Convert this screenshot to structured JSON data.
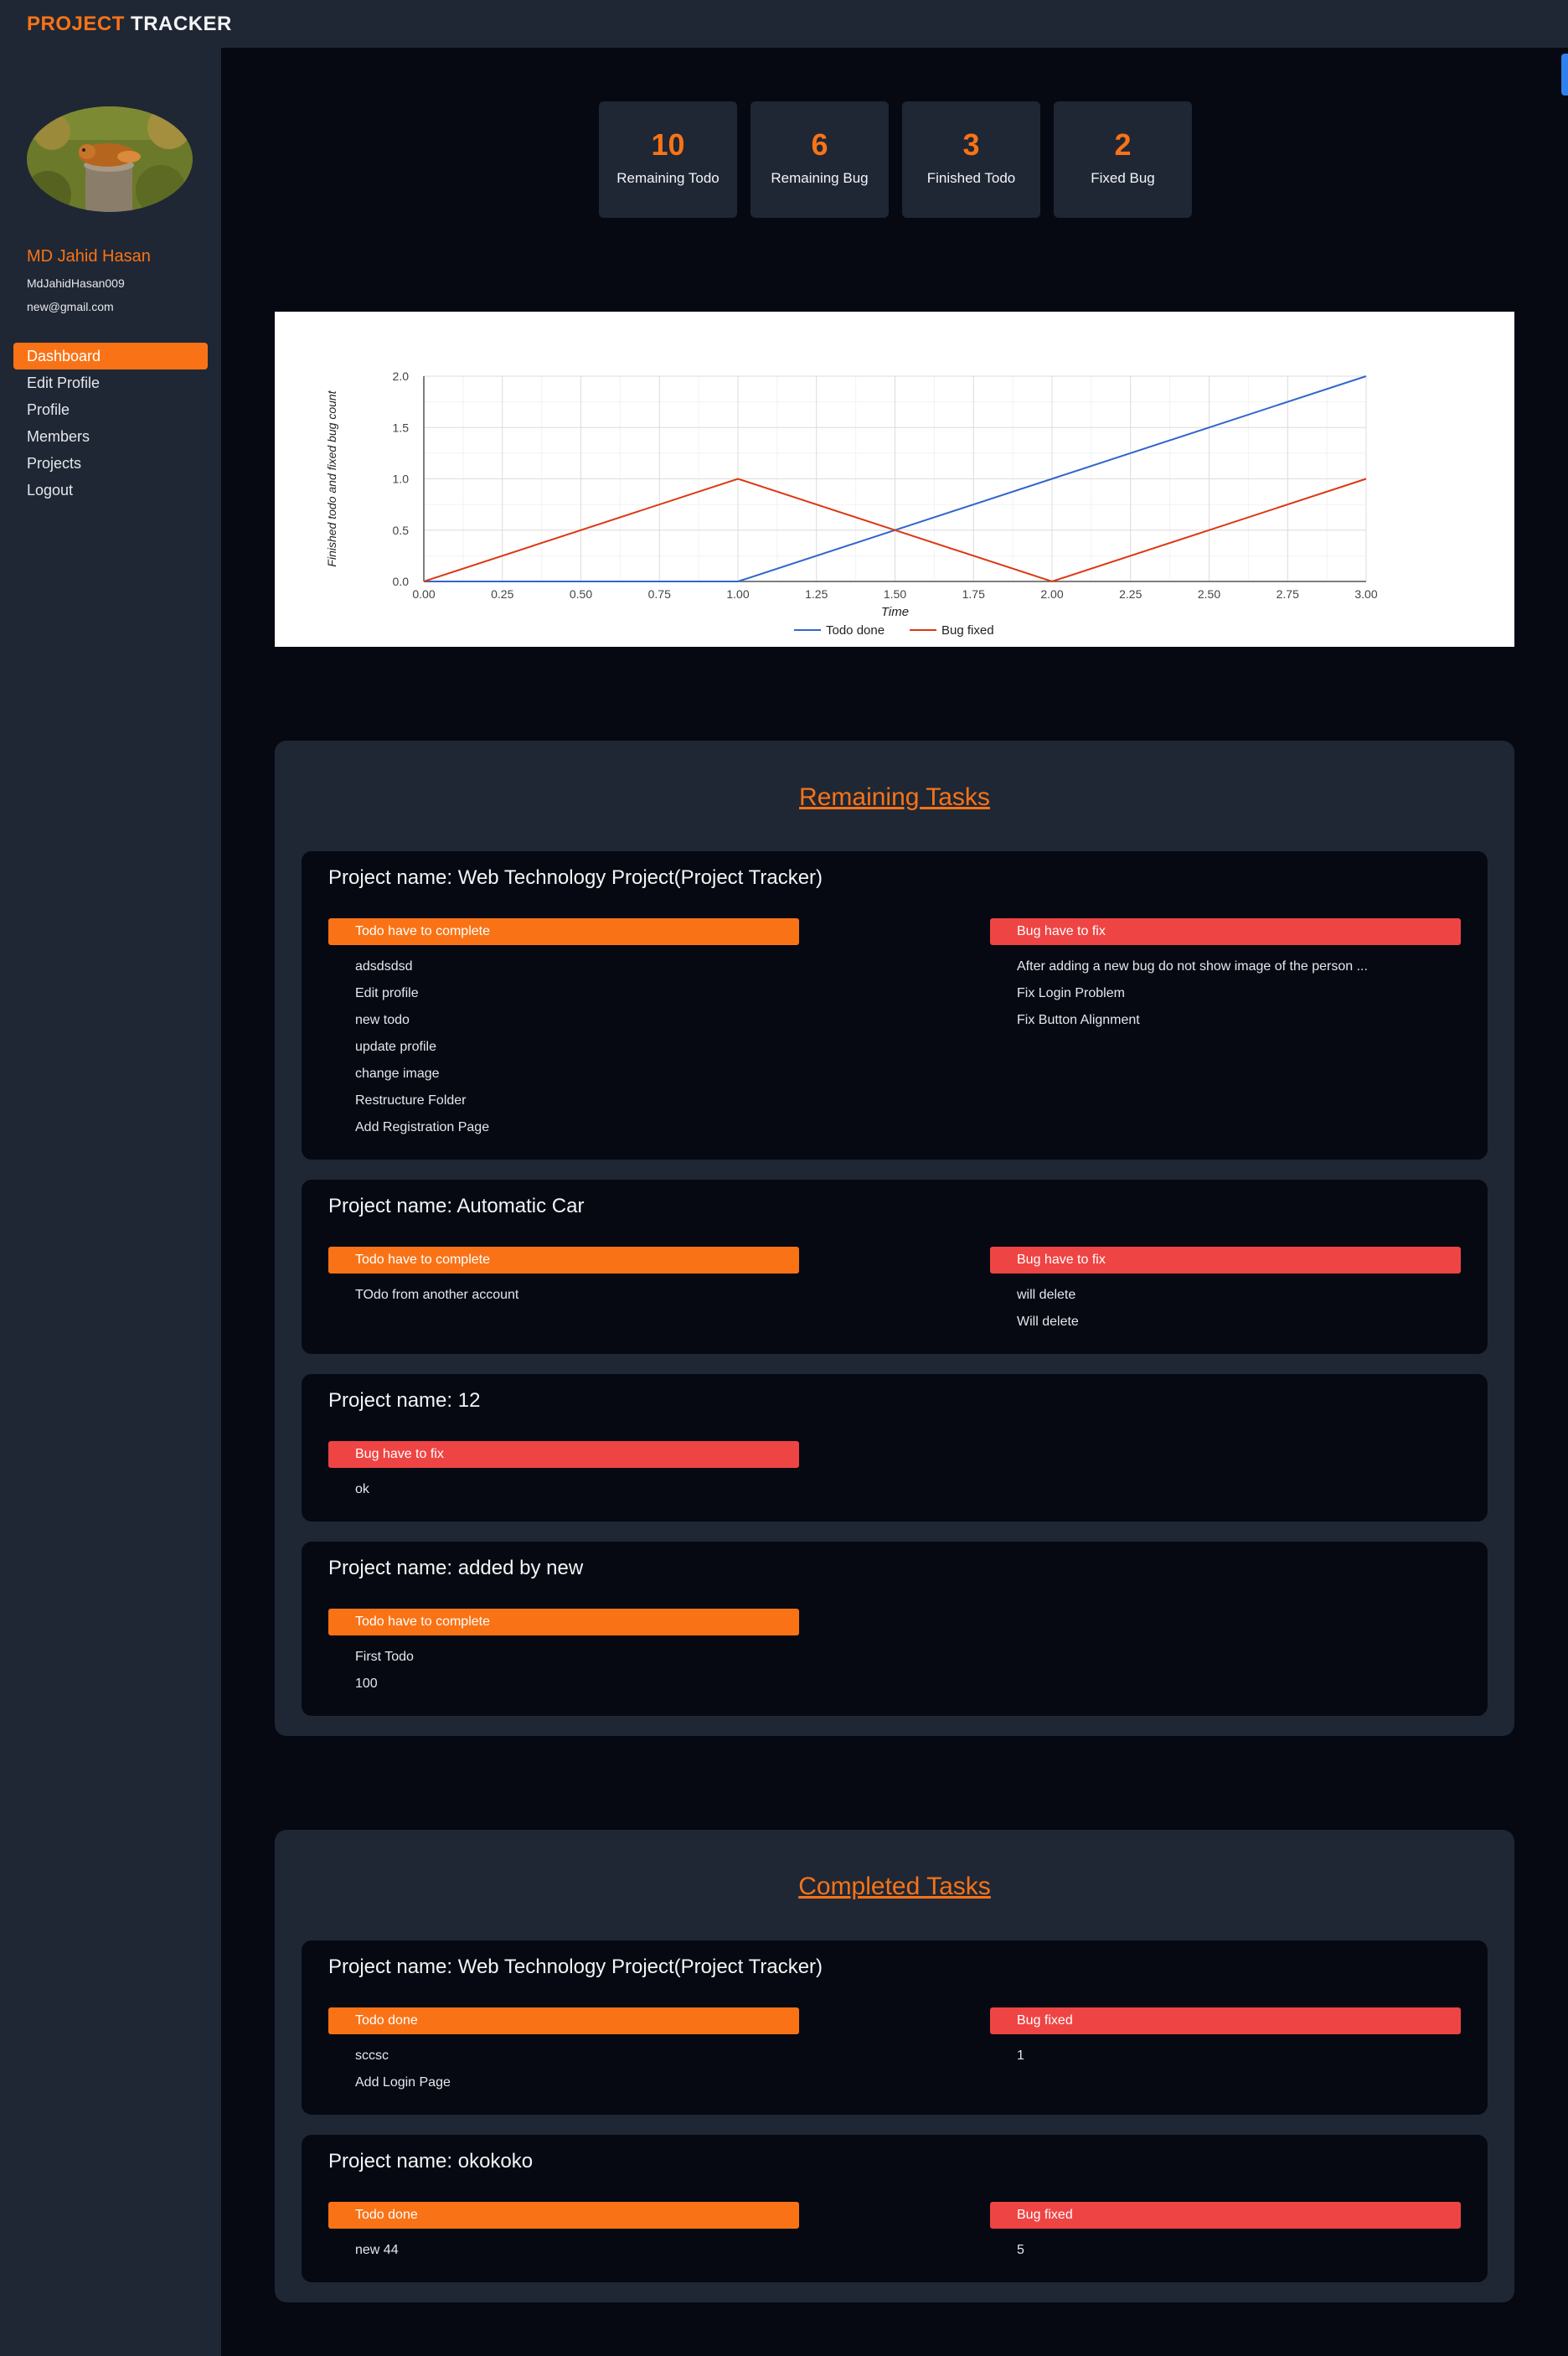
{
  "brand": {
    "part1": "PROJECT",
    "part2": "TRACKER"
  },
  "user": {
    "name": "MD Jahid Hasan",
    "handle": "MdJahidHasan009",
    "email": "new@gmail.com"
  },
  "nav": [
    "Dashboard",
    "Edit Profile",
    "Profile",
    "Members",
    "Projects",
    "Logout"
  ],
  "stats": [
    {
      "value": "10",
      "label": "Remaining Todo"
    },
    {
      "value": "6",
      "label": "Remaining Bug"
    },
    {
      "value": "3",
      "label": "Finished Todo"
    },
    {
      "value": "2",
      "label": "Fixed Bug"
    }
  ],
  "chart_data": {
    "type": "line",
    "title": "",
    "xlabel": "Time",
    "ylabel": "Finished todo and fixed bug count",
    "xlim": [
      0,
      3
    ],
    "ylim": [
      0,
      2
    ],
    "x_ticks": [
      "0.00",
      "0.25",
      "0.50",
      "0.75",
      "1.00",
      "1.25",
      "1.50",
      "1.75",
      "2.00",
      "2.25",
      "2.50",
      "2.75",
      "3.00"
    ],
    "y_ticks": [
      "0.0",
      "0.5",
      "1.0",
      "1.5",
      "2.0"
    ],
    "grid": true,
    "legend": "bottom",
    "series": [
      {
        "name": "Todo done",
        "color": "#3366cc",
        "x": [
          0,
          1,
          2,
          3
        ],
        "y": [
          0,
          0,
          1,
          2
        ]
      },
      {
        "name": "Bug fixed",
        "color": "#dc3912",
        "x": [
          0,
          1,
          2,
          3
        ],
        "y": [
          0,
          1,
          0,
          1
        ]
      }
    ]
  },
  "remaining": {
    "title": "Remaining Tasks",
    "projects": [
      {
        "name": "Project name: Web Technology Project(Project Tracker)",
        "todo_head": "Todo have to complete",
        "todos": [
          "adsdsdsd",
          "Edit profile",
          "new todo",
          "update profile",
          "change image",
          "Restructure Folder",
          "Add Registration Page"
        ],
        "bug_head": "Bug have to fix",
        "bugs": [
          "After adding a new bug do not show image of the person ...",
          "Fix Login Problem",
          "Fix Button Alignment"
        ]
      },
      {
        "name": "Project name: Automatic Car",
        "todo_head": "Todo have to complete",
        "todos": [
          "TOdo from another account"
        ],
        "bug_head": "Bug have to fix",
        "bugs": [
          "will delete",
          "Will delete"
        ]
      },
      {
        "name": "Project name: 12",
        "bug_head": "Bug have to fix",
        "bugs": [
          "ok"
        ]
      },
      {
        "name": "Project name: added by new",
        "todo_head": "Todo have to complete",
        "todos": [
          "First Todo",
          "100"
        ]
      }
    ]
  },
  "completed": {
    "title": "Completed Tasks",
    "projects": [
      {
        "name": "Project name: Web Technology Project(Project Tracker)",
        "todo_head": "Todo done",
        "todos": [
          "sccsc",
          "Add Login Page"
        ],
        "bug_head": "Bug fixed",
        "bugs": [
          "1"
        ]
      },
      {
        "name": "Project name: okokoko",
        "todo_head": "Todo done",
        "todos": [
          "new 44"
        ],
        "bug_head": "Bug fixed",
        "bugs": [
          "5"
        ]
      }
    ]
  }
}
